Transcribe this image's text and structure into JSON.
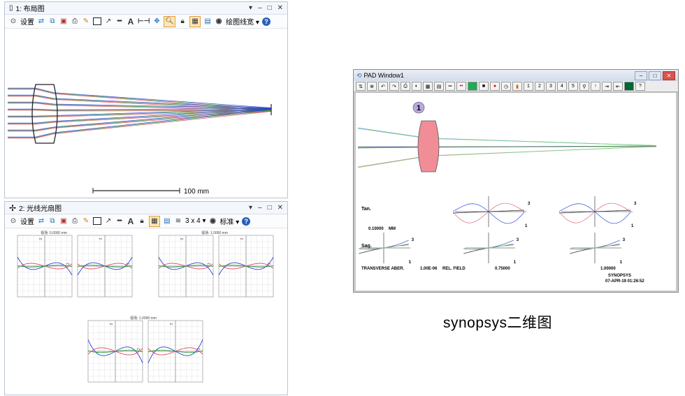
{
  "layout_window": {
    "title": "1: 布局图",
    "controls": [
      "▾",
      "–",
      "□",
      "✕"
    ],
    "toolbar": {
      "settings_label": "设置",
      "draw_style_label": "绘图线宽 ▾"
    },
    "scale_label": "100 mm"
  },
  "fan_window": {
    "title": "2: 光线光扇图",
    "controls": [
      "▾",
      "–",
      "□",
      "✕"
    ],
    "toolbar": {
      "settings_label": "设置",
      "grid_label": "3 x 4 ▾",
      "standard_label": "标准 ▾"
    },
    "plot_titles": [
      "视场: 0.0000 mm",
      "视场: 1.0000 mm",
      "视场: 1.0000 mm"
    ],
    "axis_labels": {
      "ey": "ey",
      "px": "Px",
      "ex": "ex",
      "py": "Py"
    }
  },
  "pad_window": {
    "title": "PAD Window1",
    "toolbar_numbers": [
      "1",
      "2",
      "3",
      "4",
      "5"
    ],
    "lens_marker": "1",
    "tan_label": "Tan.",
    "sag_label": "Sag.",
    "scale_value": "0.10000",
    "scale_unit": "MM",
    "curve_labels": {
      "top": "3",
      "bottom": "1"
    },
    "footer_left": "TRANSVERSE ABER.",
    "footer_value": "1.00E-06",
    "footer_field_label": "REL. FIELD",
    "fields": [
      "0.75000",
      "1.00000"
    ],
    "brand": "SYNOPSYS",
    "datetime": "07-APR-19  01:26:52"
  },
  "caption": "synopsys二维图",
  "colors": {
    "ray_blue": "#2c3cd8",
    "ray_green": "#2fa43a",
    "ray_red": "#e0455a",
    "lens_fill": "#f08d96"
  }
}
